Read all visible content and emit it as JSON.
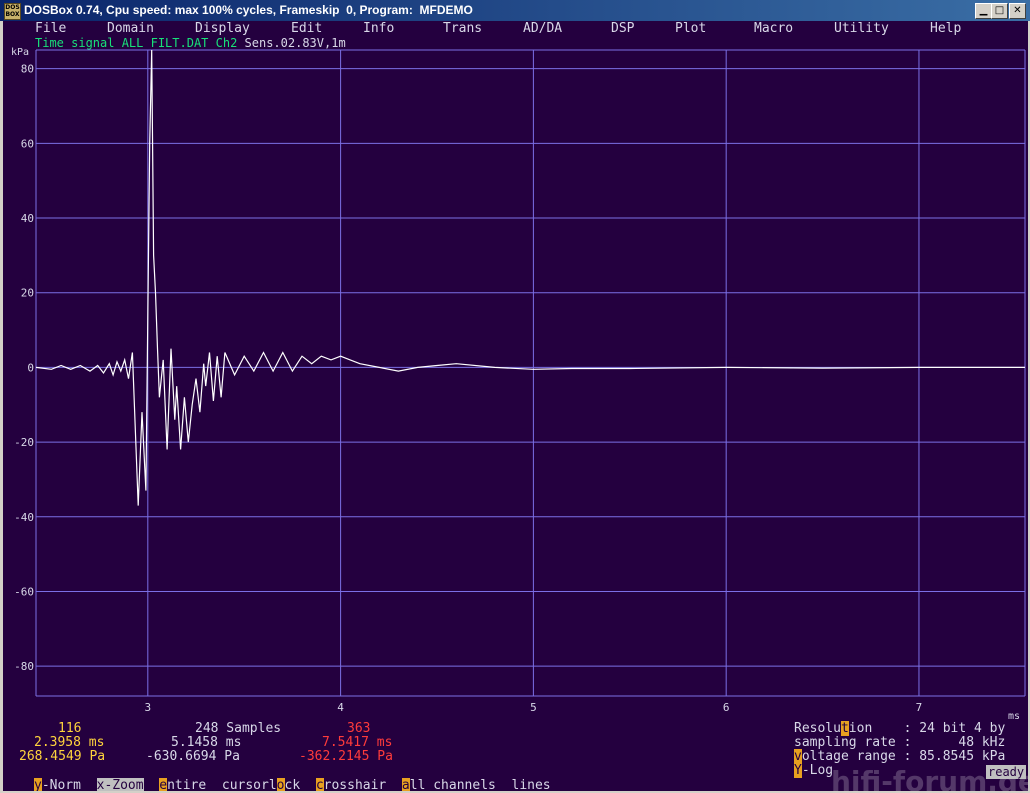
{
  "window": {
    "title": "DOSBox 0.74, Cpu speed: max 100% cycles, Frameskip  0, Program:  MFDEMO",
    "icon_text": "DOS BOX"
  },
  "menu": [
    "File",
    "Domain",
    "Display",
    "Edit",
    "Info",
    "Trans",
    "AD/DA",
    "DSP",
    "Plot",
    "Macro",
    "Utility",
    "Help"
  ],
  "signal_line": {
    "label": "Time signal ALL_FILT.DAT Ch2",
    "sens": "Sens.02.83V,1m"
  },
  "chart_data": {
    "type": "line",
    "title": "Time signal ALL_FILT.DAT Ch2",
    "xlabel": "ms",
    "ylabel": "kPa",
    "xlim": [
      2.42,
      7.55
    ],
    "ylim": [
      -88,
      85
    ],
    "x_ticks": [
      "3",
      "4",
      "5",
      "6",
      "7"
    ],
    "y_ticks": [
      "80",
      "60",
      "40",
      "20",
      "0",
      "-20",
      "-40",
      "-60",
      "-80"
    ],
    "grid": true,
    "series": [
      {
        "name": "Ch2",
        "x": [
          2.42,
          2.5,
          2.55,
          2.6,
          2.65,
          2.7,
          2.74,
          2.77,
          2.8,
          2.82,
          2.84,
          2.86,
          2.88,
          2.9,
          2.92,
          2.95,
          2.97,
          2.99,
          3.01,
          3.02,
          3.03,
          3.04,
          3.05,
          3.06,
          3.08,
          3.1,
          3.12,
          3.14,
          3.15,
          3.17,
          3.19,
          3.21,
          3.23,
          3.25,
          3.27,
          3.29,
          3.3,
          3.32,
          3.34,
          3.36,
          3.38,
          3.4,
          3.45,
          3.5,
          3.55,
          3.6,
          3.65,
          3.7,
          3.75,
          3.8,
          3.85,
          3.9,
          3.95,
          4.0,
          4.05,
          4.1,
          4.2,
          4.3,
          4.4,
          4.5,
          4.6,
          4.8,
          5.0,
          5.2,
          5.5,
          6.0,
          6.5,
          7.0,
          7.55
        ],
        "y": [
          0,
          -0.5,
          0.5,
          -0.5,
          0.5,
          -1,
          0.5,
          -1.5,
          1,
          -2,
          1.5,
          -1,
          2,
          -3,
          4,
          -37,
          -12,
          -33,
          60,
          85,
          30,
          20,
          5,
          -8,
          2,
          -22,
          5,
          -14,
          -5,
          -22,
          -8,
          -20,
          -10,
          -3,
          -12,
          1,
          -5,
          4,
          -9,
          3,
          -8,
          4,
          -2,
          3,
          -1,
          4,
          -1,
          4,
          -1,
          3,
          1,
          3,
          2,
          3,
          2,
          1,
          0,
          -1,
          0,
          0.5,
          1,
          0,
          -0.5,
          -0.3,
          -0.3,
          0,
          -0.2,
          0,
          0
        ]
      }
    ]
  },
  "status": {
    "row1": {
      "left": "116",
      "samples": "248 Samples",
      "right": "363",
      "resolution_label_pre": "Resolu",
      "resolution_key": "t",
      "resolution_label_post": "ion",
      "resolution_value": ": 24 bit 4 by"
    },
    "row2": {
      "left": "2.3958 ms",
      "mid": "5.1458 ms",
      "right": "7.5417 ms",
      "rate_label": "sampling rate",
      "rate_value": ":      48 kHz"
    },
    "row3": {
      "left": "268.4549 Pa",
      "mid": "-630.6694 Pa",
      "right": "-362.2145 Pa",
      "volt_key": "v",
      "volt_label": "oltage range",
      "volt_value": ": 85.8545 kPa"
    },
    "row4": {
      "ynorm_key": "y",
      "ynorm_label": "-Norm",
      "xzoom_key": "x",
      "xzoom_label": "-Zoom",
      "entire_key": "e",
      "entire_label": "ntire",
      "cursorlock_pre": "cursorl",
      "cursorlock_key": "o",
      "cursorlock_post": "ck",
      "crosshair_key": "c",
      "crosshair_label": "rosshair",
      "all_key": "a",
      "all_label": "ll channels",
      "lines_label": "lines",
      "ylog_key": "Y",
      "ylog_label": "-Log",
      "ready": "ready"
    }
  },
  "watermark": "hifi-forum.de",
  "colors": {
    "background": "#24003f",
    "grid": "#7b6fe6",
    "trace": "#ffffff",
    "cursor_yellow": "#ffd43c",
    "cursor_red": "#ff3b3b",
    "key_orange": "#e8a020"
  }
}
